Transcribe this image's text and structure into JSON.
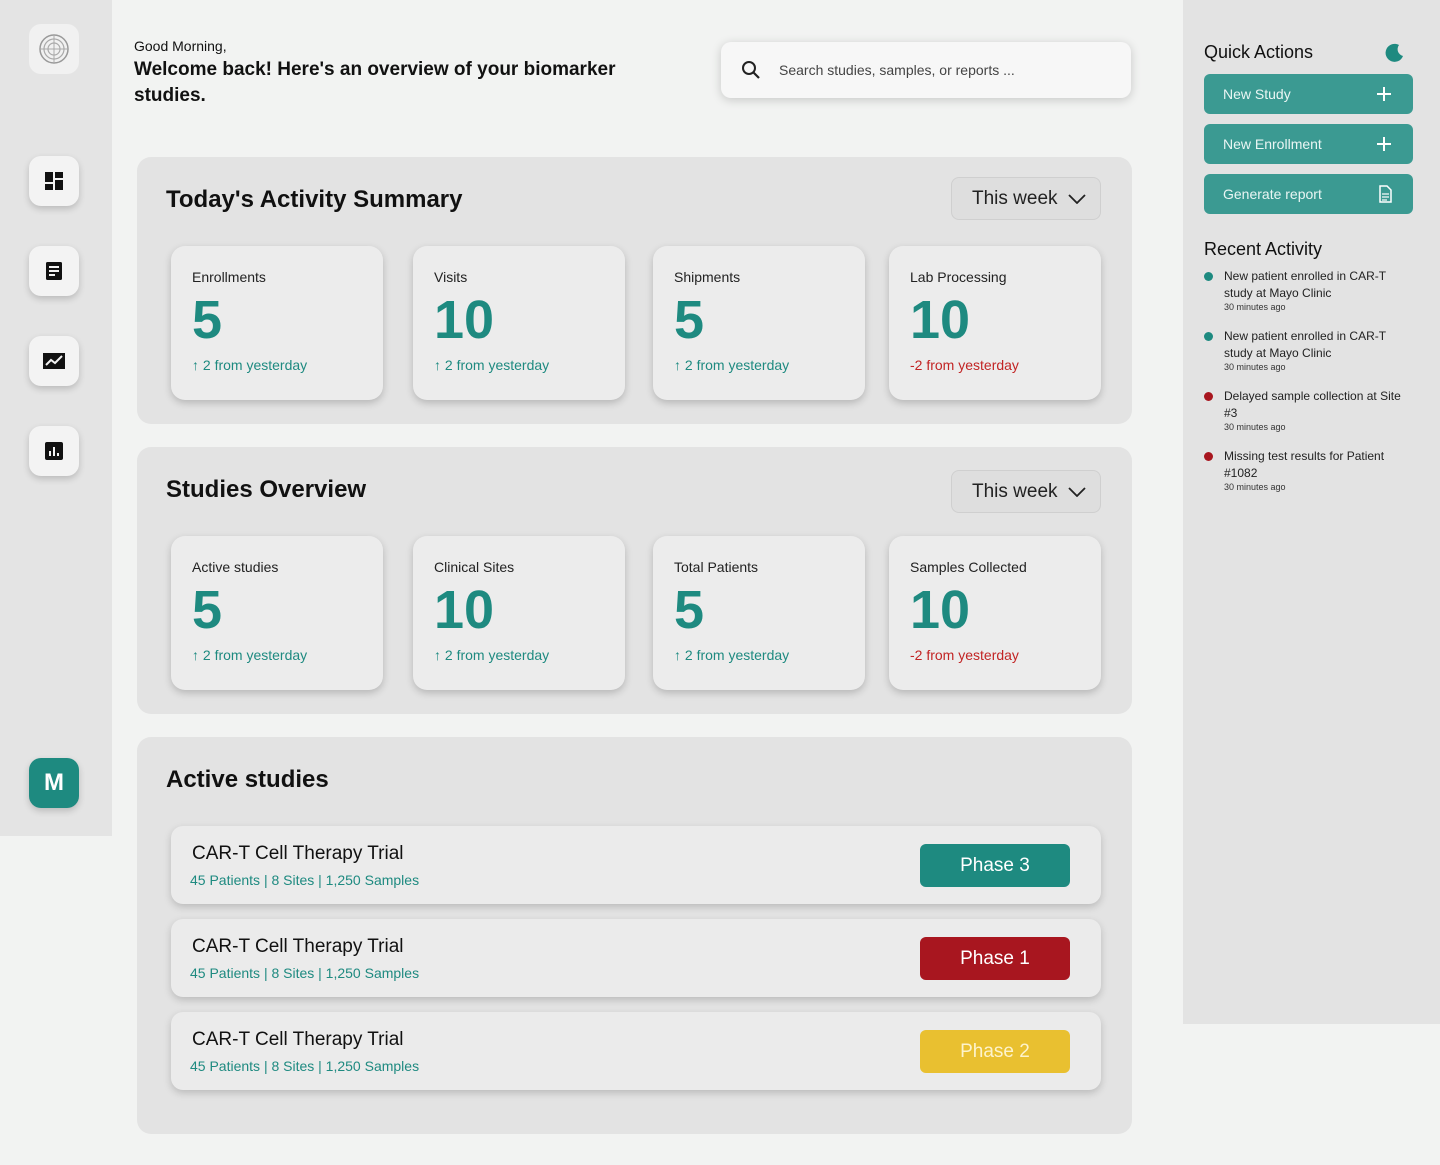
{
  "header": {
    "greeting": "Good Morning,",
    "welcome": "Welcome back! Here's an overview of your biomarker studies.",
    "search_placeholder": "Search studies, samples, or reports ..."
  },
  "sidebar": {
    "items": [
      {
        "icon": "logo-icon"
      },
      {
        "icon": "dashboard-icon"
      },
      {
        "icon": "document-icon"
      },
      {
        "icon": "trend-chart-icon"
      },
      {
        "icon": "bar-chart-icon"
      }
    ],
    "avatar_initial": "M"
  },
  "activity_summary": {
    "title": "Today's Activity Summary",
    "range": "This week",
    "cards": [
      {
        "label": "Enrollments",
        "value": "5",
        "delta": "↑ 2 from yesterday",
        "trend": "up"
      },
      {
        "label": "Visits",
        "value": "10",
        "delta": "↑ 2 from yesterday",
        "trend": "up"
      },
      {
        "label": "Shipments",
        "value": "5",
        "delta": "↑ 2 from yesterday",
        "trend": "up"
      },
      {
        "label": "Lab Processing",
        "value": "10",
        "delta": "-2 from yesterday",
        "trend": "down"
      }
    ]
  },
  "studies_overview": {
    "title": "Studies Overview",
    "range": "This week",
    "cards": [
      {
        "label": "Active studies",
        "value": "5",
        "delta": "↑ 2 from yesterday",
        "trend": "up"
      },
      {
        "label": "Clinical Sites",
        "value": "10",
        "delta": "↑ 2 from yesterday",
        "trend": "up"
      },
      {
        "label": "Total Patients",
        "value": "5",
        "delta": "↑ 2 from yesterday",
        "trend": "up"
      },
      {
        "label": "Samples Collected",
        "value": "10",
        "delta": "-2 from yesterday",
        "trend": "down"
      }
    ]
  },
  "active_studies": {
    "title": "Active studies",
    "items": [
      {
        "name": "CAR-T Cell Therapy Trial",
        "meta": "45 Patients | 8 Sites | 1,250 Samples",
        "phase": "Phase 3",
        "phase_color": "#1e8a80",
        "phase_text_color": "#ffffff"
      },
      {
        "name": "CAR-T Cell Therapy Trial",
        "meta": "45 Patients | 8 Sites | 1,250 Samples",
        "phase": "Phase 1",
        "phase_color": "#a8161f",
        "phase_text_color": "#ffffff"
      },
      {
        "name": "CAR-T Cell Therapy Trial",
        "meta": "45 Patients | 8 Sites | 1,250 Samples",
        "phase": "Phase 2",
        "phase_color": "#e9c030",
        "phase_text_color": "#fdf3cc"
      }
    ]
  },
  "quick_actions": {
    "title": "Quick Actions",
    "buttons": [
      {
        "label": "New Study",
        "icon": "plus-icon"
      },
      {
        "label": "New Enrollment",
        "icon": "plus-icon"
      },
      {
        "label": "Generate report",
        "icon": "report-file-icon"
      }
    ]
  },
  "recent_activity": {
    "title": "Recent Activity",
    "items": [
      {
        "text": "New patient enrolled in CAR-T study at Mayo Clinic",
        "time": "30 minutes ago",
        "status_color": "#1e8a80"
      },
      {
        "text": "New patient enrolled in CAR-T study at Mayo Clinic",
        "time": "30 minutes ago",
        "status_color": "#1e8a80"
      },
      {
        "text": "Delayed sample collection at Site #3",
        "time": "30 minutes ago",
        "status_color": "#a8161f"
      },
      {
        "text": "Missing test results for Patient #1082",
        "time": "30 minutes ago",
        "status_color": "#a8161f"
      }
    ]
  },
  "colors": {
    "accent": "#1e8a80",
    "negative": "#c22424"
  }
}
